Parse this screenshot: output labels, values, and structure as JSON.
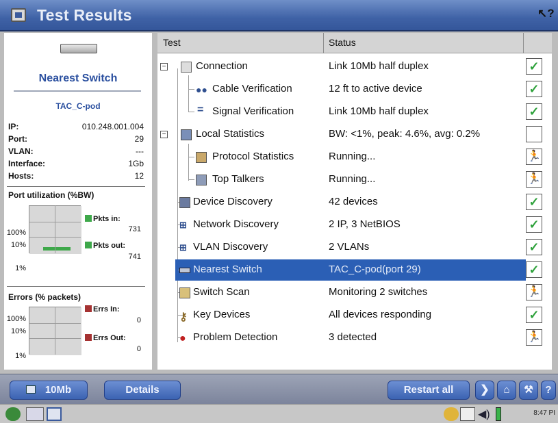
{
  "window": {
    "title": "Test Results",
    "help_icon": "help-cursor-icon"
  },
  "left_panel": {
    "device_icon": "switch-device-icon",
    "heading": "Nearest Switch",
    "device_name": "TAC_C-pod",
    "fields": [
      {
        "label": "IP:",
        "value": "010.248.001.004"
      },
      {
        "label": "Port:",
        "value": "29"
      },
      {
        "label": "VLAN:",
        "value": "---"
      },
      {
        "label": "Interface:",
        "value": "1Gb"
      },
      {
        "label": "Hosts:",
        "value": "12"
      }
    ],
    "port_util": {
      "title": "Port utilization (%BW)",
      "ylabels": [
        "100%",
        "10%",
        "1%"
      ],
      "legend": [
        {
          "label": "Pkts in:",
          "value": "731",
          "color": "#3ea84a"
        },
        {
          "label": "Pkts out:",
          "value": "741",
          "color": "#3ea84a"
        }
      ]
    },
    "errors": {
      "title": "Errors (% packets)",
      "ylabels": [
        "100%",
        "10%",
        "1%"
      ],
      "legend": [
        {
          "label": "Errs In:",
          "value": "0",
          "color": "#a53232"
        },
        {
          "label": "Errs Out:",
          "value": "0",
          "color": "#a53232"
        }
      ]
    }
  },
  "table": {
    "headers": {
      "test": "Test",
      "status": "Status"
    },
    "rows": [
      {
        "test": "Connection",
        "status": "Link 10Mb half duplex",
        "icon": "folder-icon",
        "result": "pass"
      },
      {
        "test": "Cable Verification",
        "status": "12 ft to active device",
        "icon": "cable-icon",
        "result": "pass"
      },
      {
        "test": "Signal Verification",
        "status": "Link 10Mb half duplex",
        "icon": "signal-icon",
        "result": "pass"
      },
      {
        "test": "Local Statistics",
        "status": "BW: <1%, peak: 4.6%, avg: 0.2%",
        "icon": "statistics-icon",
        "result": "empty"
      },
      {
        "test": "Protocol Statistics",
        "status": "Running...",
        "icon": "protocol-icon",
        "result": "running"
      },
      {
        "test": "Top Talkers",
        "status": "Running...",
        "icon": "talkers-icon",
        "result": "running"
      },
      {
        "test": "Device Discovery",
        "status": "42 devices",
        "icon": "device-icon",
        "result": "pass"
      },
      {
        "test": "Network Discovery",
        "status": "2 IP, 3 NetBIOS",
        "icon": "network-icon",
        "result": "pass"
      },
      {
        "test": "VLAN Discovery",
        "status": "2 VLANs",
        "icon": "vlan-icon",
        "result": "pass"
      },
      {
        "test": "Nearest Switch",
        "status": "TAC_C-pod(port 29)",
        "icon": "switch-icon",
        "result": "pass"
      },
      {
        "test": "Switch Scan",
        "status": "Monitoring 2 switches",
        "icon": "scan-icon",
        "result": "running"
      },
      {
        "test": "Key Devices",
        "status": "All devices responding",
        "icon": "key-icon",
        "result": "pass"
      },
      {
        "test": "Problem Detection",
        "status": "3 detected",
        "icon": "problem-icon",
        "result": "running"
      }
    ]
  },
  "toolbar": {
    "speed_label": "10Mb",
    "details_label": "Details",
    "restart_label": "Restart all"
  },
  "taskbar": {
    "clock": "8:47 PI"
  },
  "colors": {
    "title_bar": "#3f62a6",
    "selection": "#2b5fb5",
    "pass": "#2da13a",
    "accent_text": "#2a4f9f"
  }
}
